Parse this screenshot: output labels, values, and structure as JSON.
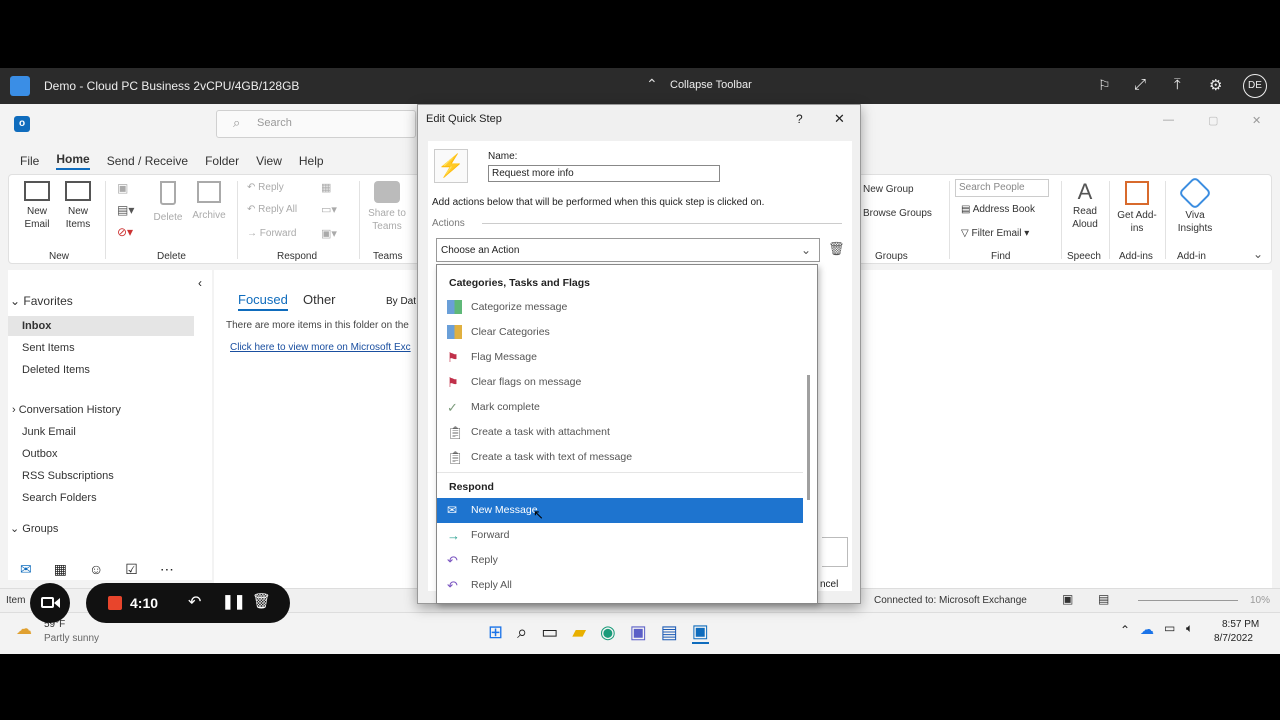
{
  "cloudpc": {
    "title": "Demo - Cloud PC Business 2vCPU/4GB/128GB",
    "collapse_label": "Collapse Toolbar",
    "avatar": "DE"
  },
  "search": {
    "placeholder": "Search"
  },
  "menu": [
    "File",
    "Home",
    "Send / Receive",
    "Folder",
    "View",
    "Help"
  ],
  "ribbon": {
    "new_email": "New Email",
    "new_items": "New Items",
    "delete": "Delete",
    "archive": "Archive",
    "reply": "Reply",
    "reply_all": "Reply All",
    "forward": "Forward",
    "share_to_teams": "Share to Teams",
    "new_group": "New Group",
    "browse_groups": "Browse Groups",
    "search_people": "Search People",
    "address_book": "Address Book",
    "filter_email": "Filter Email",
    "read_aloud": "Read Aloud",
    "get_addins": "Get Add-ins",
    "viva_insights": "Viva Insights",
    "groups": {
      "new": "New",
      "delete": "Delete",
      "respond": "Respond",
      "teams": "Teams",
      "groups": "Groups",
      "find": "Find",
      "speech": "Speech",
      "addins": "Add-ins",
      "addin": "Add-in"
    }
  },
  "folders": {
    "favorites": "Favorites",
    "inbox": "Inbox",
    "sent": "Sent Items",
    "deleted": "Deleted Items",
    "conversation_history": "Conversation History",
    "junk": "Junk Email",
    "outbox": "Outbox",
    "rss": "RSS Subscriptions",
    "search_folders": "Search Folders",
    "groups": "Groups"
  },
  "maillist": {
    "focused": "Focused",
    "other": "Other",
    "by_date": "By Dat",
    "notice": "There are more items in this folder on the",
    "link": "Click here to view more on Microsoft Exc"
  },
  "dialog": {
    "title": "Edit Quick Step",
    "help": "?",
    "close": "✕",
    "name_label": "Name:",
    "name_value": "Request more info",
    "instruction": "Add actions below that will be performed when this quick step is clicked on.",
    "actions_label": "Actions",
    "combo_value": "Choose an Action",
    "cancel_partial": "ncel"
  },
  "dropdown": {
    "section1": "Categories, Tasks and Flags",
    "items1": [
      "Categorize message",
      "Clear Categories",
      "Flag Message",
      "Clear flags on message",
      "Mark complete",
      "Create a task with attachment",
      "Create a task with text of message"
    ],
    "section2": "Respond",
    "items2": [
      "New Message",
      "Forward",
      "Reply",
      "Reply All"
    ]
  },
  "status": {
    "items_partial": "Item",
    "connected": "Connected to: Microsoft Exchange",
    "zoom": "10%"
  },
  "taskbar": {
    "weather_temp": "59°F",
    "weather": "Partly sunny",
    "time": "8:57 PM",
    "date": "8/7/2022"
  },
  "recorder": {
    "time": "4:10"
  }
}
